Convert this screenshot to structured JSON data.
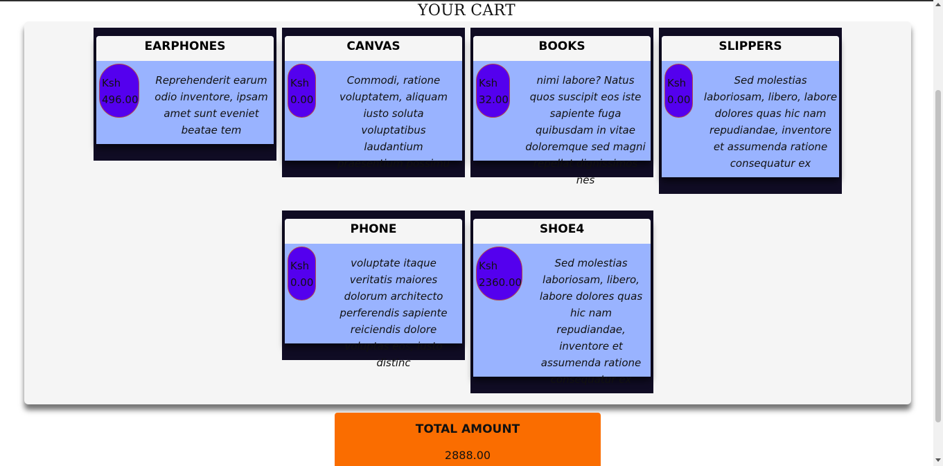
{
  "page": {
    "title": "YOUR CART"
  },
  "cart": {
    "items": [
      {
        "name": "EARPHONES",
        "currency": "Ksh",
        "price": "496.00",
        "description": "Reprehenderit earum odio inventore, ipsam amet sunt eveniet beatae tem"
      },
      {
        "name": "CANVAS",
        "currency": "Ksh",
        "price": "0.00",
        "description": "Commodi, ratione voluptatem, aliquam iusto soluta voluptatibus laudantium praesentium possimu"
      },
      {
        "name": "BOOKS",
        "currency": "Ksh",
        "price": "32.00",
        "description": "nimi labore? Natus quos suscipit eos iste sapiente fuga quibusdam in vitae doloremque sed magni repellat dignissimos nes"
      },
      {
        "name": "SLIPPERS",
        "currency": "Ksh",
        "price": "0.00",
        "description": "Sed molestias laboriosam, libero, labore dolores quas hic nam repudiandae, inventore et assumenda ratione consequatur ex"
      },
      {
        "name": "PHONE",
        "currency": "Ksh",
        "price": "0.00",
        "description": "voluptate itaque veritatis maiores dolorum architecto perferendis sapiente reiciendis dolore voluptas eos, iusto distinc"
      },
      {
        "name": "SHOE4",
        "currency": "Ksh",
        "price": "2360.00",
        "description": "Sed molestias laboriosam, libero, labore dolores quas hic nam repudiandae, inventore et assumenda ratione consequatur ex"
      }
    ]
  },
  "total": {
    "label": "TOTAL AMOUNT",
    "value": "2888.00"
  },
  "colors": {
    "card_frame": "#100c24",
    "card_body": "#99b3ff",
    "price_pill": "#5400ee",
    "total_box": "#fa6d00",
    "panel": "#f5f5f5"
  }
}
